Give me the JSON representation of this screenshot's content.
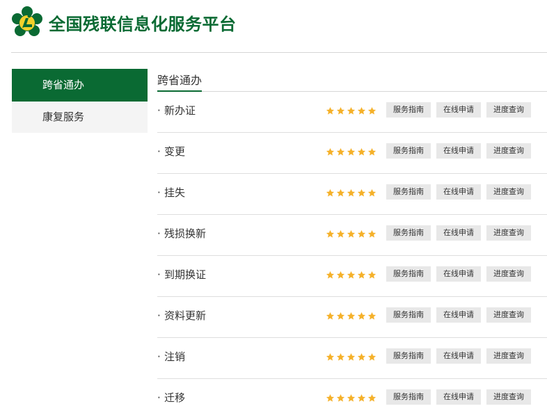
{
  "header": {
    "site_title": "全国残联信息化服务平台"
  },
  "sidebar": {
    "items": [
      {
        "label": "跨省通办",
        "active": true
      },
      {
        "label": "康复服务",
        "active": false
      }
    ]
  },
  "main": {
    "section_title": "跨省通办",
    "rows": [
      {
        "label": "新办证",
        "rating": 5
      },
      {
        "label": "变更",
        "rating": 5
      },
      {
        "label": "挂失",
        "rating": 5
      },
      {
        "label": "残损换新",
        "rating": 5
      },
      {
        "label": "到期换证",
        "rating": 5
      },
      {
        "label": "资料更新",
        "rating": 5
      },
      {
        "label": "注销",
        "rating": 5
      },
      {
        "label": "迁移",
        "rating": 5
      }
    ],
    "buttons": {
      "guide": "服务指南",
      "apply": "在线申请",
      "progress": "进度查询"
    }
  },
  "colors": {
    "brand_green": "#0a6a33",
    "star": "#f5b12a",
    "logo_yellow": "#f3d12b"
  }
}
